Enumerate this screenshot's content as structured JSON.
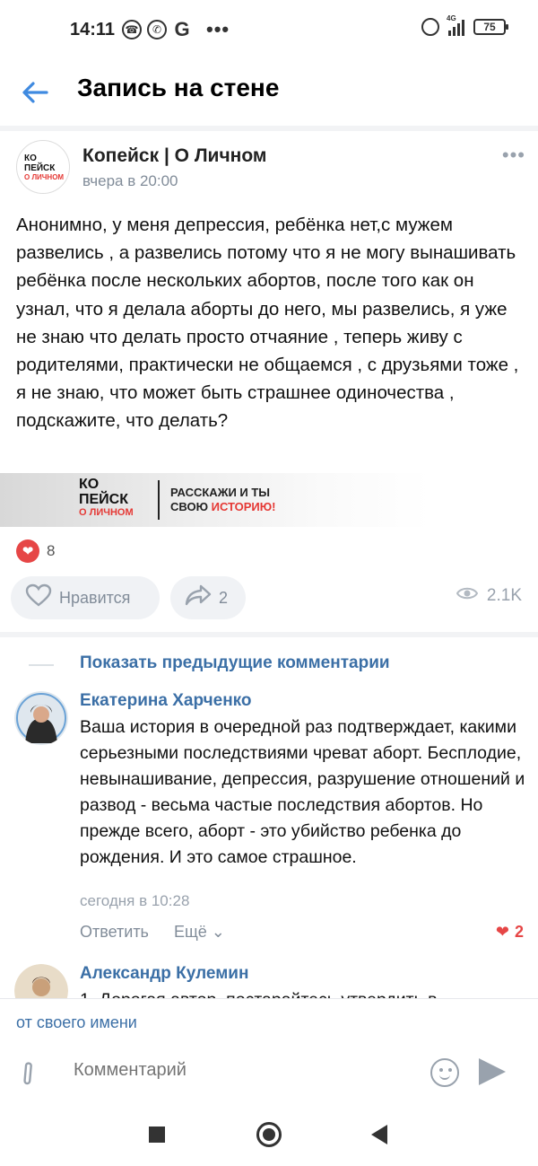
{
  "status": {
    "time": "14:11",
    "network": "4G",
    "battery": "75"
  },
  "header": {
    "title": "Запись на стене"
  },
  "post": {
    "group_name": "Копейск | О Личном",
    "group_logo": {
      "line1": "КО",
      "line2": "ПЕЙСК",
      "line3": "О ЛИЧНОМ"
    },
    "time": "вчера в 20:00",
    "text": "Анонимно, у меня депрессия, ребёнка нет,с мужем развелись , а развелись потому что я не могу вынашивать ребёнка после нескольких абортов, после того как он узнал, что я делала аборты до него, мы развелись, я уже не знаю что делать просто отчаяние , теперь живу с родителями, практически не общаемся , с друзьями тоже , я не знаю, что может быть страшнее одиночества , подскажите, что делать?",
    "banner": {
      "logo_line1": "КО",
      "logo_line2": "ПЕЙСК",
      "logo_line3": "О ЛИЧНОМ",
      "text_line1": "РАССКАЖИ И ТЫ",
      "text_line2_a": "СВОЮ ",
      "text_line2_b": "ИСТОРИЮ!"
    },
    "likes_count": "8",
    "like_label": "Нравится",
    "shares_count": "2",
    "views": "2.1K"
  },
  "comments_section": {
    "show_previous": "Показать предыдущие комментарии",
    "comments": [
      {
        "author": "Екатерина Харченко",
        "text": "Ваша история в очередной раз подтверждает, какими серьезными последствиями чреват аборт. Бесплодие, невынашивание, депрессия, разрушение отношений и развод - весьма частые последствия абортов. Но прежде всего, аборт - это убийство ребенка до рождения. И это самое страшное.",
        "time": "сегодня в 10:28",
        "reply": "Ответить",
        "more": "Ещё",
        "likes": "2"
      },
      {
        "author": "Александр Кулемин",
        "text": "1. Дорогая автор, постарайтесь утвердить в"
      }
    ]
  },
  "composer": {
    "from_name": "от своего имени",
    "placeholder": "Комментарий"
  },
  "colors": {
    "accent": "#3f8ae0",
    "link": "#3b6fa6",
    "like_red": "#e64646"
  }
}
